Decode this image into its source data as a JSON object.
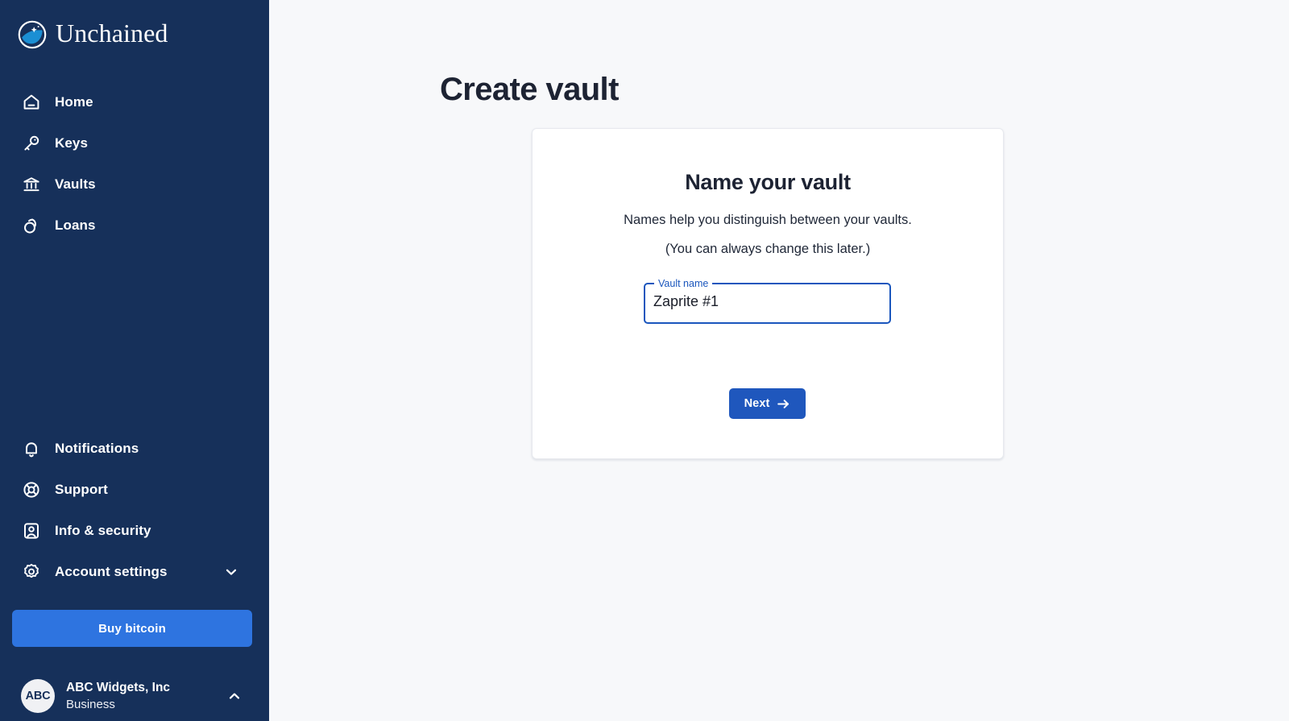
{
  "brand": {
    "name": "Unchained",
    "logo_icon": "unchained-logo-icon"
  },
  "sidebar": {
    "nav_primary": [
      {
        "label": "Home",
        "icon": "home-icon"
      },
      {
        "label": "Keys",
        "icon": "key-icon"
      },
      {
        "label": "Vaults",
        "icon": "bank-icon"
      },
      {
        "label": "Loans",
        "icon": "loans-circles-icon"
      }
    ],
    "nav_secondary": [
      {
        "label": "Notifications",
        "icon": "bell-icon"
      },
      {
        "label": "Support",
        "icon": "lifebuoy-icon"
      },
      {
        "label": "Info & security",
        "icon": "user-card-icon"
      },
      {
        "label": "Account settings",
        "icon": "gear-icon",
        "trailing_icon": "chevron-down-icon"
      }
    ],
    "buy_bitcoin_label": "Buy bitcoin",
    "account": {
      "avatar_initials": "ABC",
      "name": "ABC Widgets, Inc",
      "type": "Business",
      "trailing_icon": "chevron-up-icon"
    },
    "colors": {
      "background": "#16305a",
      "buy_button": "#2e74e0",
      "text": "#ffffff"
    }
  },
  "main": {
    "page_title": "Create vault",
    "background": "#f7f8fa",
    "card": {
      "title": "Name your vault",
      "subtitle_line1": "Names help you distinguish between your vaults.",
      "subtitle_line2": "(You can always change this later.)",
      "field": {
        "label": "Vault name",
        "value": "Zaprite #1",
        "placeholder": "Vault name",
        "focused_border_color": "#1a56bd"
      },
      "next_button": {
        "label": "Next",
        "icon": "arrow-right-icon",
        "color": "#1f57bd"
      }
    }
  }
}
